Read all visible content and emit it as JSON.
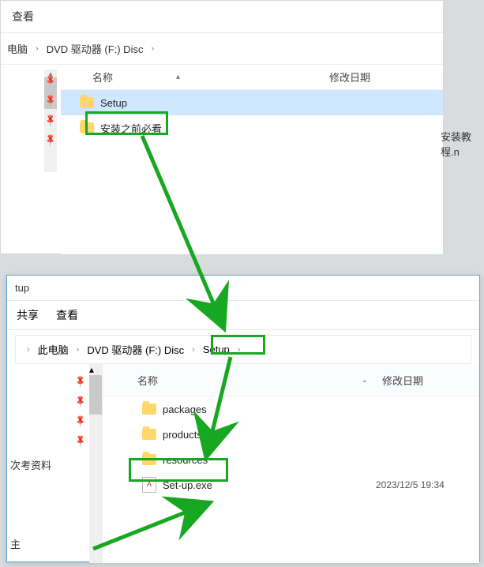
{
  "window1": {
    "menu_view": "查看",
    "crumbs": {
      "pc": "电脑",
      "drive": "DVD 驱动器 (F:) Disc"
    },
    "columns": {
      "name": "名称",
      "date": "修改日期"
    },
    "rows": [
      {
        "name": "Setup",
        "selected": true
      },
      {
        "name": "安装之前必看",
        "selected": false
      }
    ],
    "side_text": "安装教程.n"
  },
  "window2": {
    "title_fragment": "tup",
    "tabs": {
      "share": "共享",
      "view": "查看"
    },
    "crumbs": {
      "pc": "此电脑",
      "drive": "DVD 驱动器 (F:) Disc",
      "folder": "Setup"
    },
    "columns": {
      "name": "名称",
      "date": "修改日期"
    },
    "rows": [
      {
        "type": "folder",
        "name": "packages",
        "date": ""
      },
      {
        "type": "folder",
        "name": "products",
        "date": ""
      },
      {
        "type": "folder",
        "name": "resources",
        "date": ""
      },
      {
        "type": "file",
        "name": "Set-up.exe",
        "date": "2023/12/5 19:34"
      }
    ],
    "side_items": {
      "a": "次考资料",
      "b": "主"
    }
  }
}
